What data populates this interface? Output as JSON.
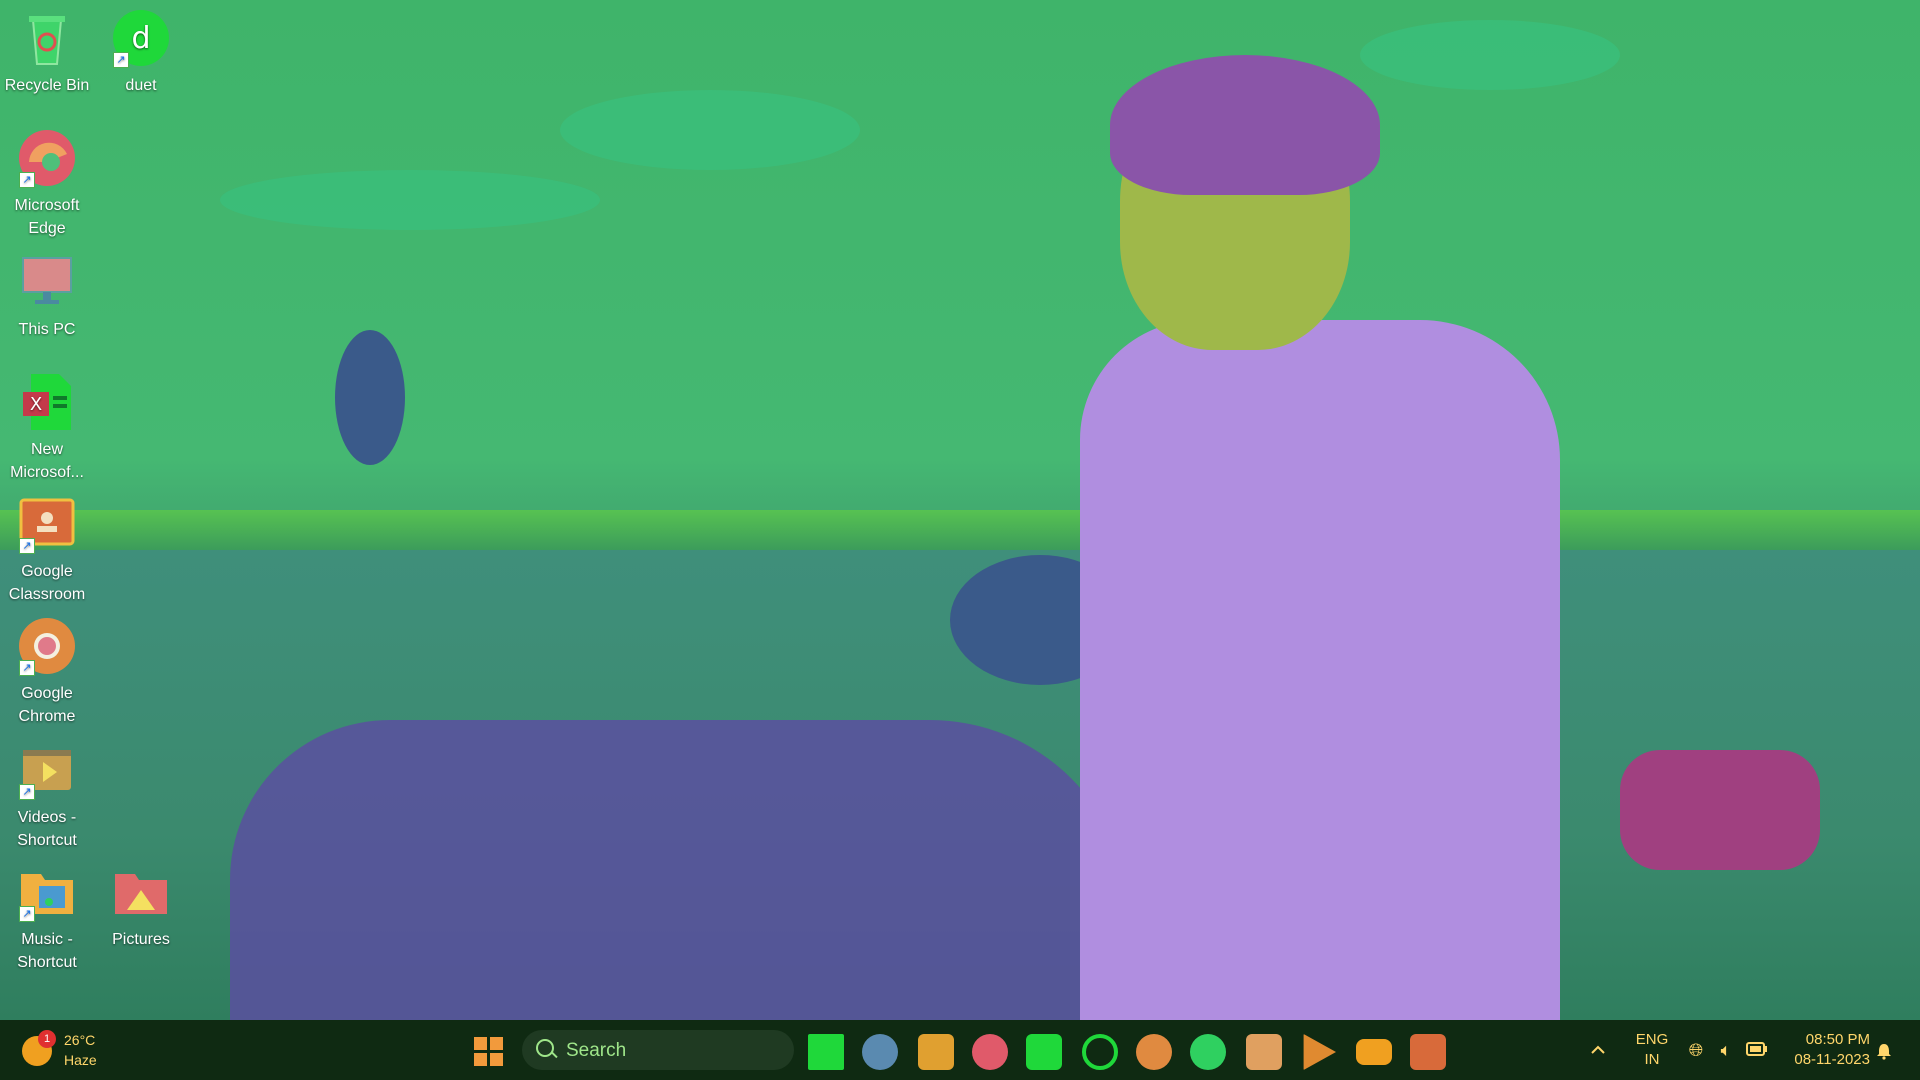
{
  "desktop": {
    "icons": [
      {
        "label": "Recycle Bin",
        "icon": "recycle-bin-icon"
      },
      {
        "label": "duet",
        "icon": "duet-app-icon"
      },
      {
        "label": "Microsoft Edge",
        "icon": "edge-icon"
      },
      {
        "label": "This PC",
        "icon": "monitor-icon"
      },
      {
        "label": "New Microsof...",
        "icon": "excel-file-icon"
      },
      {
        "label": "Google Classroom",
        "icon": "classroom-icon"
      },
      {
        "label": "Google Chrome",
        "icon": "chrome-icon"
      },
      {
        "label": "Videos - Shortcut",
        "icon": "videos-folder-icon"
      },
      {
        "label": "Music - Shortcut",
        "icon": "music-folder-icon"
      },
      {
        "label": "Pictures",
        "icon": "pictures-folder-icon"
      }
    ]
  },
  "taskbar": {
    "weather": {
      "temp": "26°C",
      "condition": "Haze",
      "badge": "1"
    },
    "search": {
      "placeholder": "Search"
    },
    "apps": [
      "task-view-icon",
      "chat-icon",
      "file-explorer-icon",
      "edge-icon",
      "store-icon",
      "photos-icon",
      "chrome-icon",
      "whatsapp-icon",
      "instagram-icon",
      "play-store-icon",
      "youtube-icon",
      "classroom-icon"
    ],
    "tray": {
      "language_line1": "ENG",
      "language_line2": "IN",
      "time": "08:50 PM",
      "date": "08-11-2023"
    }
  },
  "colors": {
    "taskbar_bg": "#0f2a12",
    "tray_text": "#ffd66b",
    "wallpaper_sky": "#3fb46a",
    "wallpaper_shirt": "#b08ee0"
  }
}
